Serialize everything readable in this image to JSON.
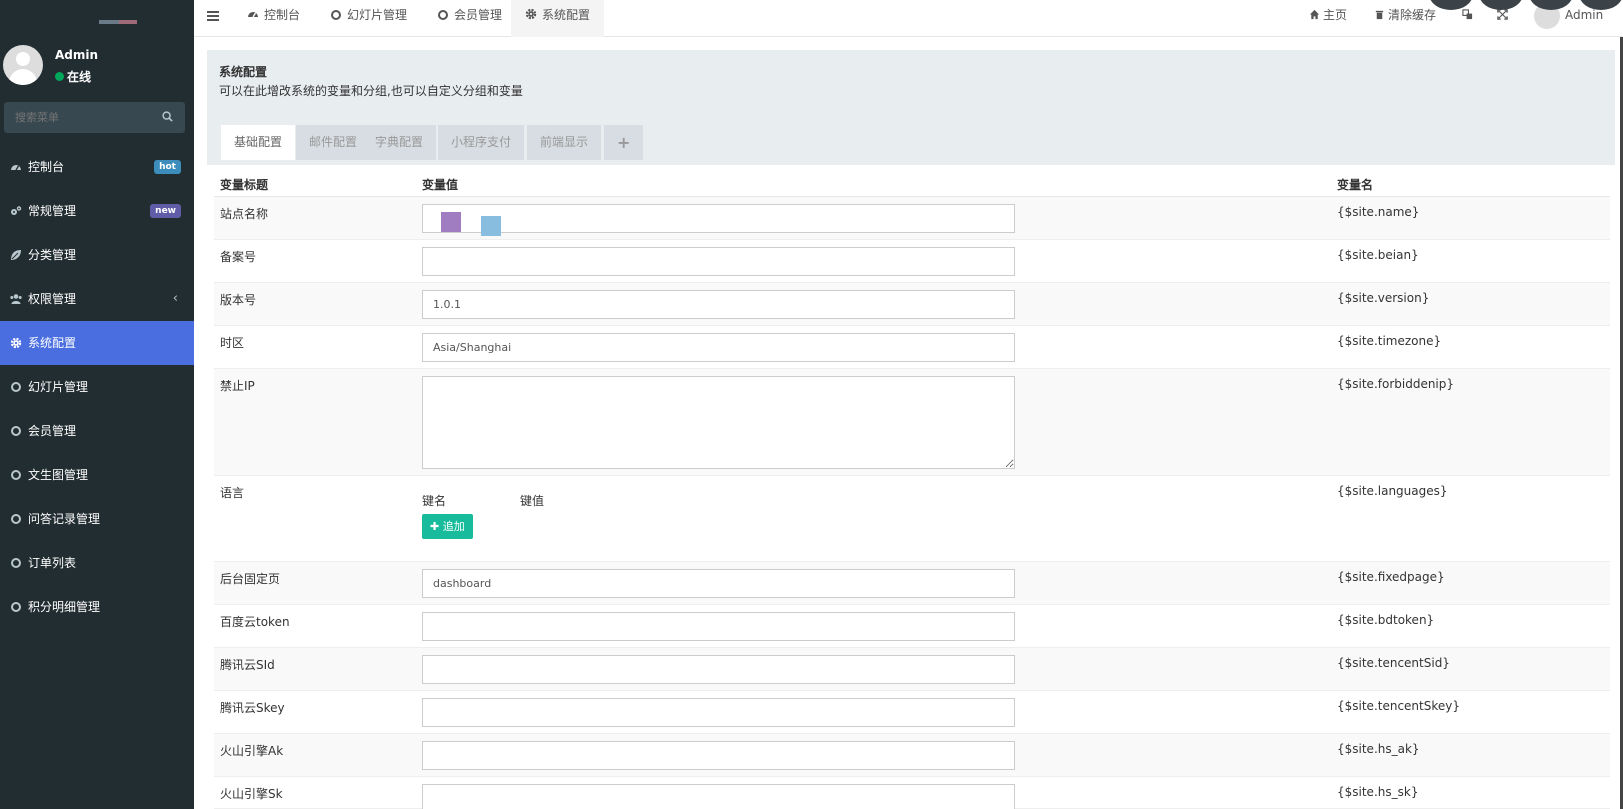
{
  "sidebar": {
    "user": {
      "name": "Admin",
      "status": "在线"
    },
    "search": {
      "placeholder": "搜索菜单"
    },
    "items": [
      {
        "label": "控制台",
        "icon": "dashboard-icon",
        "badge": "hot"
      },
      {
        "label": "常规管理",
        "icon": "cogs-icon",
        "badge": "new"
      },
      {
        "label": "分类管理",
        "icon": "leaf-icon"
      },
      {
        "label": "权限管理",
        "icon": "group-icon",
        "chevron": "‹"
      },
      {
        "label": "系统配置",
        "icon": "gear-icon",
        "active": true
      },
      {
        "label": "幻灯片管理",
        "icon": "circle-icon"
      },
      {
        "label": "会员管理",
        "icon": "circle-icon"
      },
      {
        "label": "文生图管理",
        "icon": "circle-icon"
      },
      {
        "label": "问答记录管理",
        "icon": "circle-icon"
      },
      {
        "label": "订单列表",
        "icon": "circle-icon"
      },
      {
        "label": "积分明细管理",
        "icon": "circle-icon"
      }
    ]
  },
  "navbar": {
    "tabs": [
      {
        "label": "控制台",
        "icon": "dashboard-icon"
      },
      {
        "label": "幻灯片管理",
        "icon": "circle-icon"
      },
      {
        "label": "会员管理",
        "icon": "circle-icon"
      },
      {
        "label": "系统配置",
        "icon": "gear-icon",
        "active": true
      }
    ],
    "home_label": "主页",
    "clear_cache_label": "清除缓存",
    "user_label": "Admin"
  },
  "panel": {
    "title": "系统配置",
    "description": "可以在此增改系统的变量和分组,也可以自定义分组和变量",
    "tabs": [
      "基础配置",
      "邮件配置",
      "字典配置",
      "小程序支付",
      "前端显示",
      "+"
    ]
  },
  "table": {
    "headers": {
      "title": "变量标题",
      "value": "变量值",
      "name": "变量名"
    },
    "rows": [
      {
        "title": "站点名称",
        "value": "",
        "var": "{$site.name}"
      },
      {
        "title": "备案号",
        "value": "",
        "var": "{$site.beian}"
      },
      {
        "title": "版本号",
        "value": "1.0.1",
        "var": "{$site.version}"
      },
      {
        "title": "时区",
        "value": "Asia/Shanghai",
        "var": "{$site.timezone}"
      },
      {
        "title": "禁止IP",
        "value": "",
        "var": "{$site.forbiddenip}"
      },
      {
        "title": "语言",
        "key_label": "键名",
        "value_label": "键值",
        "add_label": "追加",
        "var": "{$site.languages}"
      },
      {
        "title": "后台固定页",
        "value": "dashboard",
        "var": "{$site.fixedpage}"
      },
      {
        "title": "百度云token",
        "value": "",
        "var": "{$site.bdtoken}"
      },
      {
        "title": "腾讯云SId",
        "value": "",
        "var": "{$site.tencentSid}"
      },
      {
        "title": "腾讯云Skey",
        "value": "",
        "var": "{$site.tencentSkey}"
      },
      {
        "title": "火山引擎Ak",
        "value": "",
        "var": "{$site.hs_ak}"
      },
      {
        "title": "火山引擎Sk",
        "value": "",
        "var": "{$site.hs_sk}"
      }
    ]
  },
  "colors": {
    "sidebar_bg": "#222d32",
    "active_menu": "#4a6ee0",
    "add_button": "#18bc9c",
    "online": "#00a65a"
  }
}
